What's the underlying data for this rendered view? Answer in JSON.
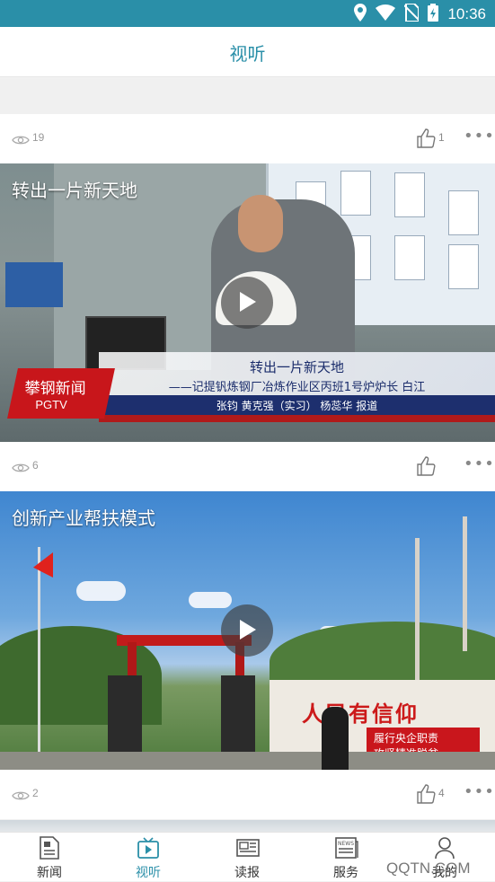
{
  "status_bar": {
    "time": "10:36"
  },
  "header": {
    "title": "视听"
  },
  "cards": [
    {
      "views": "19",
      "likes": "1"
    },
    {
      "title": "转出一片新天地",
      "views": "6",
      "likes": "",
      "overlay": {
        "logo_line1": "攀钢新闻",
        "logo_line2": "PGTV",
        "headline": "转出一片新天地",
        "subhead": "——记提钒炼钢厂冶炼作业区丙班1号炉炉长  白江",
        "credits": "张钧  黄克强（实习）  杨蕊华  报道"
      }
    },
    {
      "title": "创新产业帮扶模式",
      "views": "2",
      "likes": "4",
      "overlay": {
        "wall_slogan": "人民有信仰",
        "banner_line1": "履行央企职责",
        "banner_line2": "攻坚精准脱贫"
      }
    }
  ],
  "bottom_nav": [
    {
      "label": "新闻",
      "icon": "news-icon"
    },
    {
      "label": "视听",
      "icon": "video-icon",
      "active": true
    },
    {
      "label": "读报",
      "icon": "newspaper-icon"
    },
    {
      "label": "服务",
      "icon": "service-icon"
    },
    {
      "label": "我的",
      "icon": "user-icon"
    }
  ],
  "watermark": "QQTN.COM",
  "colors": {
    "accent": "#2a8fa8",
    "status_bar": "#2a8fa8"
  }
}
